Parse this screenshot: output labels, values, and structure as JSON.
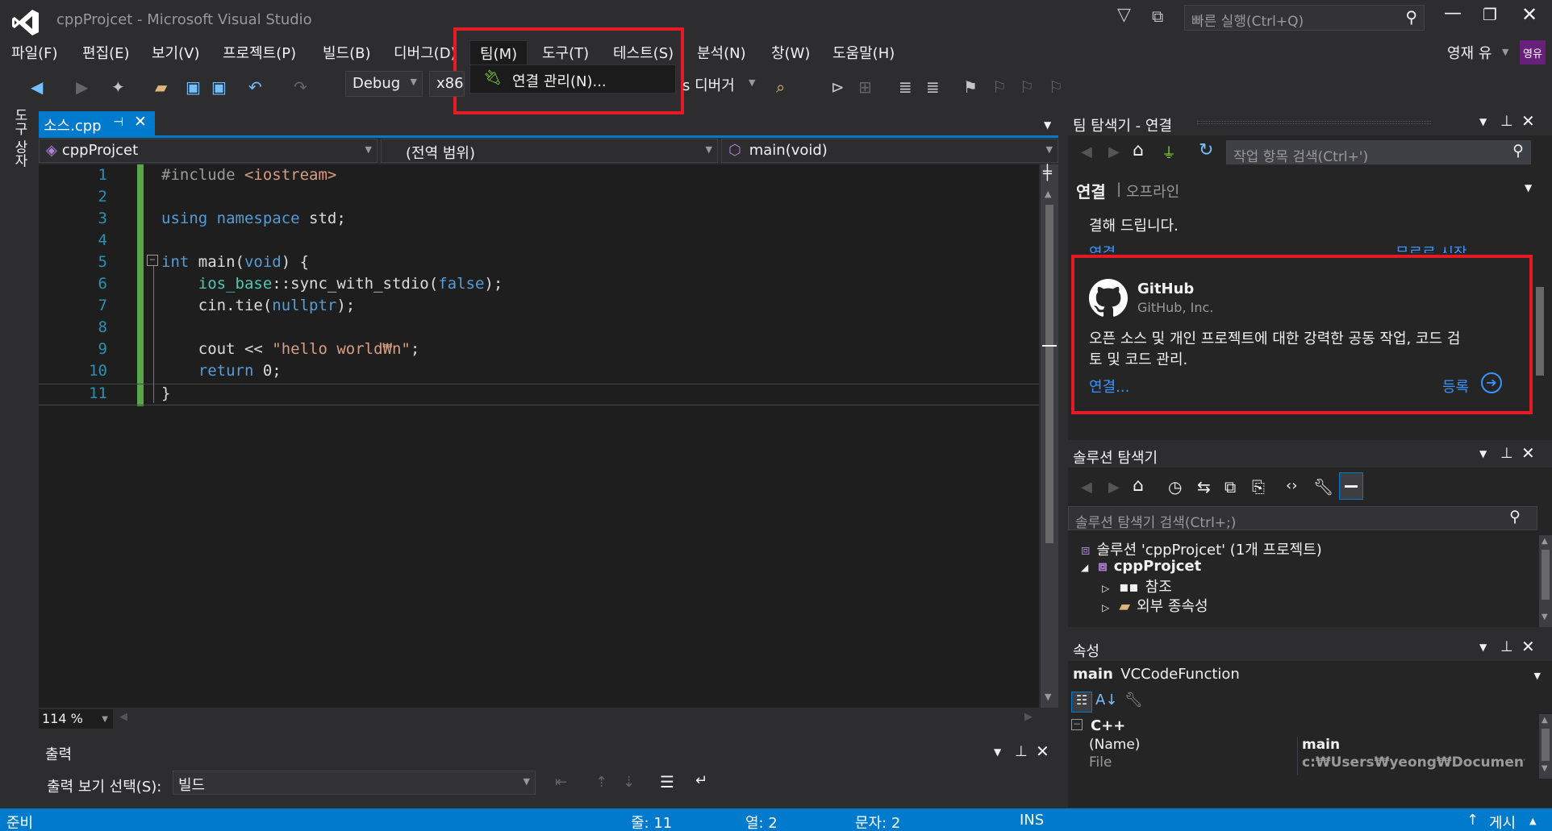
{
  "window": {
    "title": "cppProjcet - Microsoft Visual Studio",
    "quick_launch_placeholder": "빠른 실행(Ctrl+Q)",
    "user_name": "영재 유",
    "user_badge": "영유"
  },
  "menu": {
    "items": [
      "파일(F)",
      "편집(E)",
      "보기(V)",
      "프로젝트(P)",
      "빌드(B)",
      "디버그(D)",
      "팀(M)",
      "도구(T)",
      "테스트(S)",
      "분석(N)",
      "창(W)",
      "도움말(H)"
    ],
    "dropdown_item": "연결 관리(N)..."
  },
  "toolbar": {
    "config": "Debug",
    "platform": "x86",
    "debugger_suffix": "s 디버거"
  },
  "side_tab": "도구 상자",
  "editor": {
    "tab_label": "소스.cpp",
    "project_combo": "cppProjcet",
    "scope_combo": "(전역 범위)",
    "member_combo": "main(void)",
    "zoom": "114 %",
    "line_numbers": [
      "1",
      "2",
      "3",
      "4",
      "5",
      "6",
      "7",
      "8",
      "9",
      "10",
      "11"
    ]
  },
  "team_explorer": {
    "title": "팀 탐색기 - 연결",
    "search_placeholder": "작업 항목 검색(Ctrl+')",
    "heading_connect": "연결",
    "heading_offline": "오프라인",
    "partial_text": "결해 드립니다.",
    "top_connect_link": "연결...",
    "top_free_link": "무료로 시작",
    "github_name": "GitHub",
    "github_company": "GitHub, Inc.",
    "github_desc_1": "오픈 소스 및 개인 프로젝트에 대한 강력한 공동 작업, 코드 검",
    "github_desc_2": "토 및 코드 관리.",
    "github_connect": "연결...",
    "github_register": "등록"
  },
  "solution_explorer": {
    "title": "솔루션 탐색기",
    "search_placeholder": "솔루션 탐색기 검색(Ctrl+;)",
    "solution": "솔루션 'cppProjcet' (1개 프로젝트)",
    "project": "cppProjcet",
    "references": "참조",
    "external_deps": "외부 종속성"
  },
  "properties": {
    "title": "속성",
    "object_name": "main",
    "object_type": "VCCodeFunction",
    "category": "C++",
    "row1_name": "(Name)",
    "row1_value": "main",
    "row2_name": "File",
    "row2_value": "c:₩Users₩yeong₩Documents₩V"
  },
  "output": {
    "title": "출력",
    "label": "출력 보기 선택(S):",
    "source": "빌드"
  },
  "status": {
    "ready": "준비",
    "line": "줄: 11",
    "col": "열: 2",
    "ch": "문자: 2",
    "ins": "INS",
    "publish": "게시"
  }
}
